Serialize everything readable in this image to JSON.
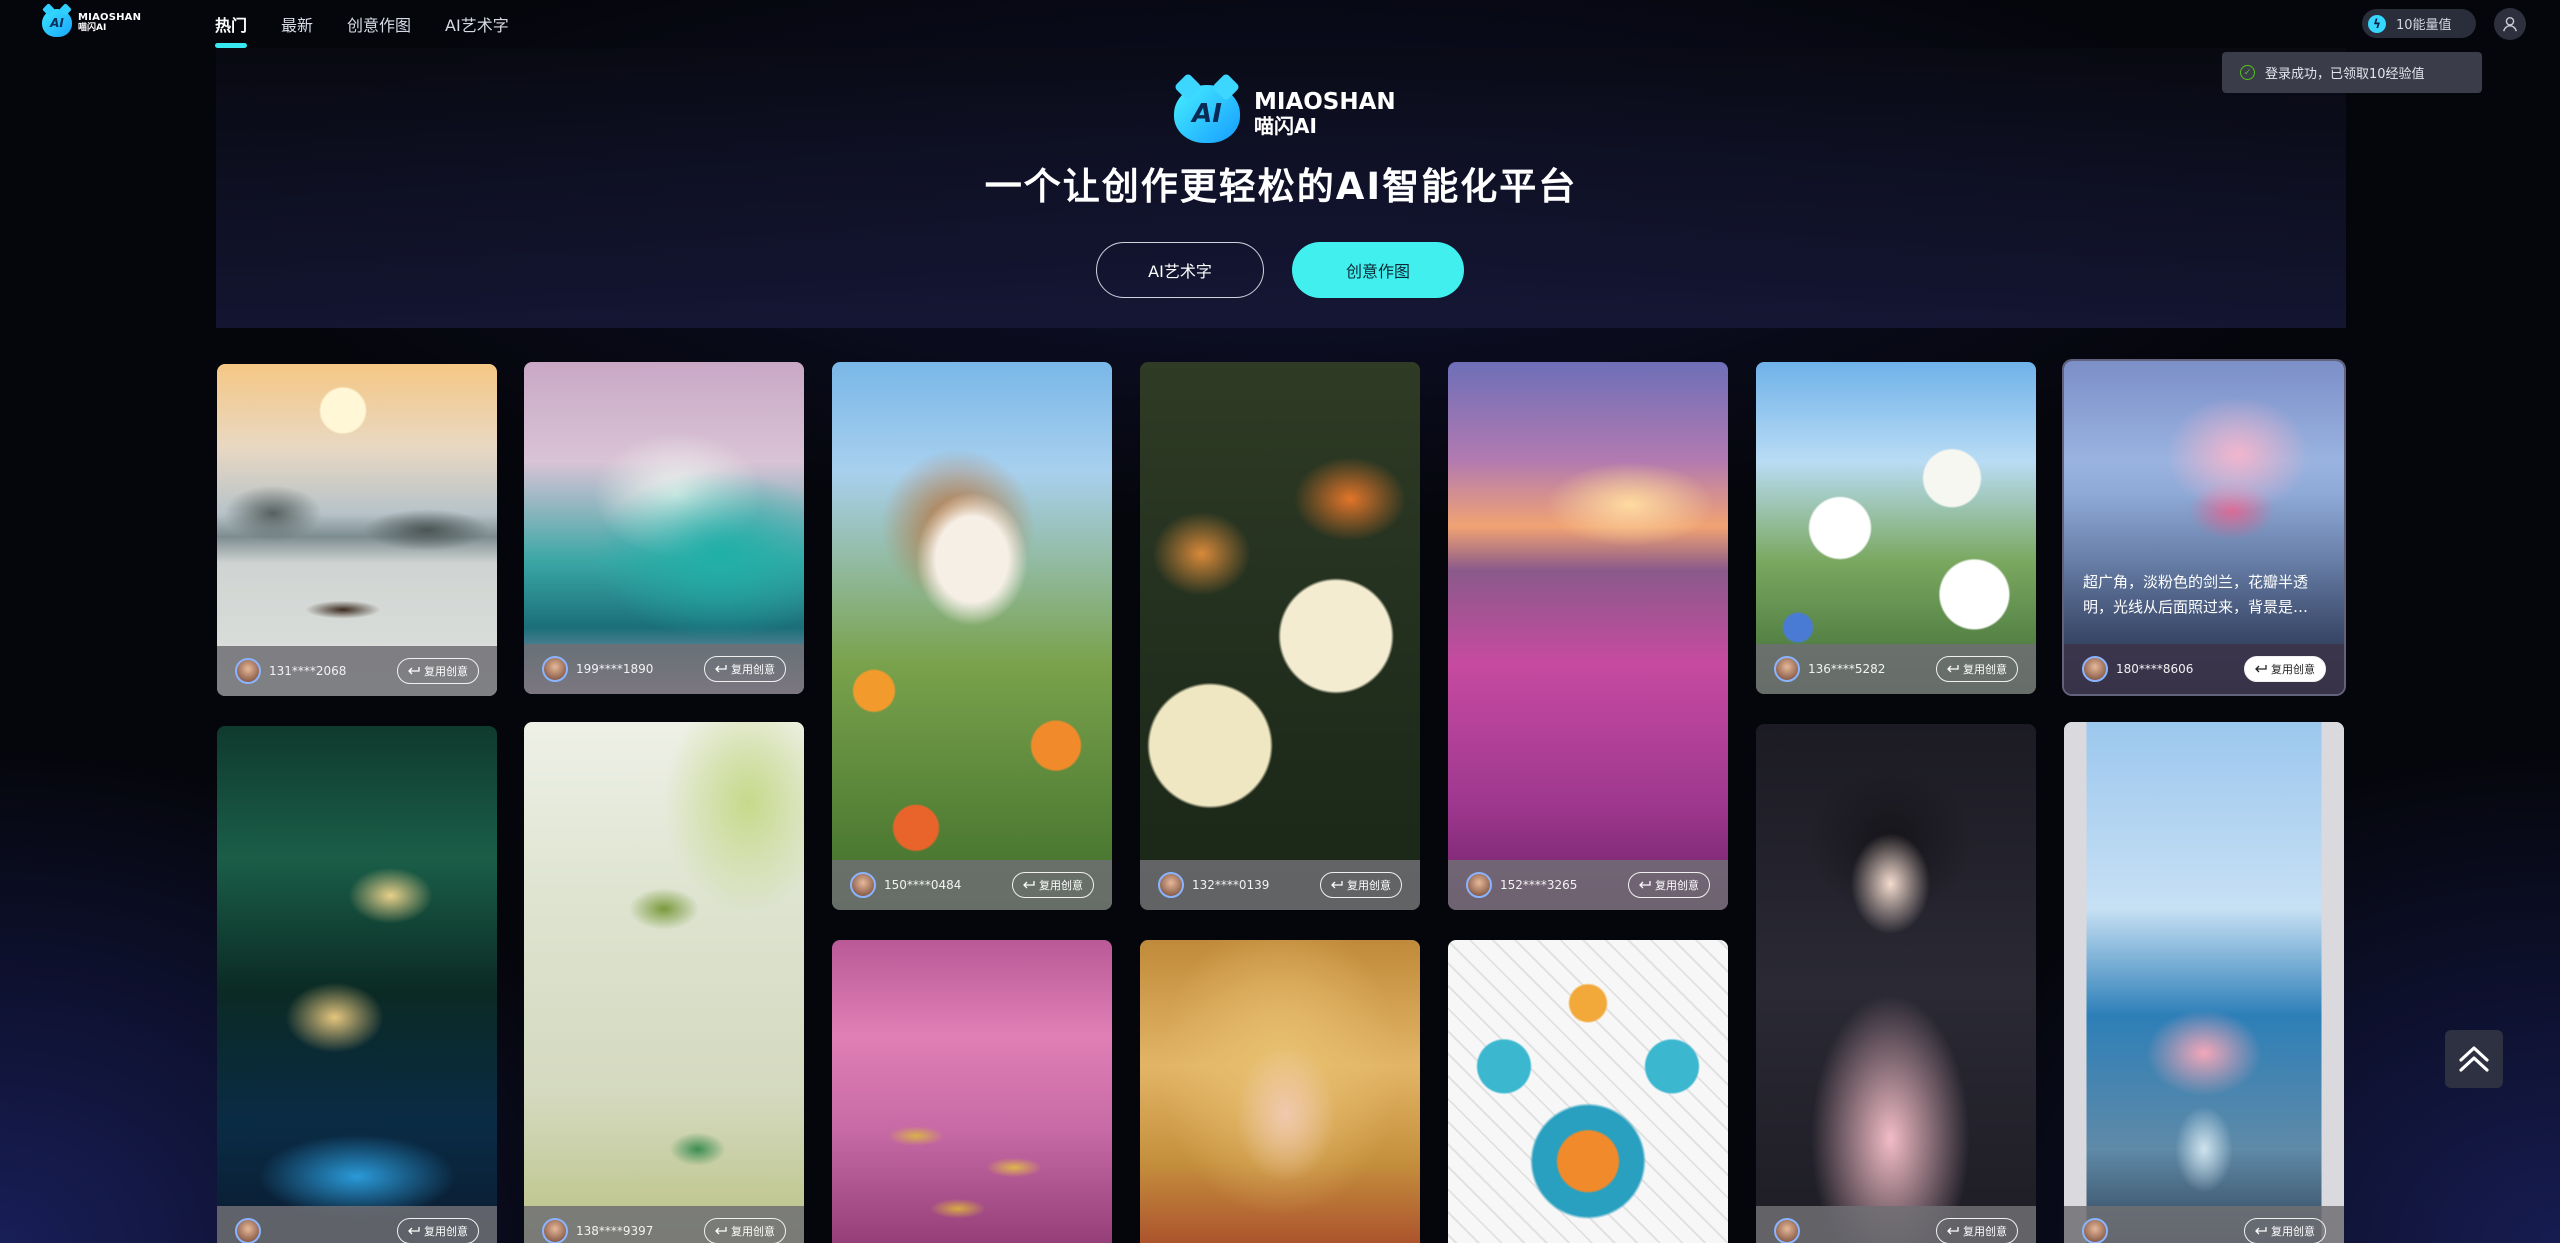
{
  "brand": {
    "name_en": "MIAOSHAN",
    "name_cn": "喵闪AI",
    "logo_mark": "AI"
  },
  "nav": {
    "tabs": [
      {
        "label": "热门",
        "active": true
      },
      {
        "label": "最新",
        "active": false
      },
      {
        "label": "创意作图",
        "active": false
      },
      {
        "label": "AI艺术字",
        "active": false
      }
    ]
  },
  "header_right": {
    "energy_label": "10能量值",
    "energy_icon": "lightning-icon",
    "user_icon": "user-icon"
  },
  "toast": {
    "text": "登录成功，已领取10经验值",
    "icon": "check-circle-icon",
    "color": "#52c41a"
  },
  "hero": {
    "logo_en": "MIAOSHAN",
    "logo_cn": "喵闪AI",
    "logo_mark": "AI",
    "title": "一个让创作更轻松的AI智能化平台",
    "btn_art_text": "AI艺术字",
    "btn_creative": "创意作图",
    "accent": "#41efef"
  },
  "reuse_label": "复用创意",
  "cards": [
    {
      "user": "131****2068",
      "theme": "misty lake, boat, mountains, sunset"
    },
    {
      "user": "199****1890",
      "theme": "teal ocean wave, pink sky"
    },
    {
      "user": "150****0484",
      "theme": "puppy in flower field"
    },
    {
      "user": "132****0139",
      "theme": "butterflies on white roses"
    },
    {
      "user": "152****3265",
      "theme": "pink rose field at sunset"
    },
    {
      "user": "136****5282",
      "theme": "white daisies, blue sky"
    },
    {
      "user": "180****8606",
      "theme": "pink lily, blue sky",
      "desc": "超广角，淡粉色的剑兰，花瓣半透明，光线从后面照过来，背景是…",
      "hovered": true
    },
    {
      "user": "",
      "theme": "butterflies over sparkling water"
    },
    {
      "user": "138****9397",
      "theme": "bird on blossom branch"
    },
    {
      "user": "",
      "theme": "gold coins on pink water"
    },
    {
      "user": "",
      "theme": "blonde girl portrait"
    },
    {
      "user": "",
      "theme": "stained glass mandala"
    },
    {
      "user": "",
      "theme": "girl in hanfu, snow"
    },
    {
      "user": "",
      "theme": "flower vase by sea window"
    }
  ],
  "scroll_top_icon": "double-chevron-up-icon"
}
